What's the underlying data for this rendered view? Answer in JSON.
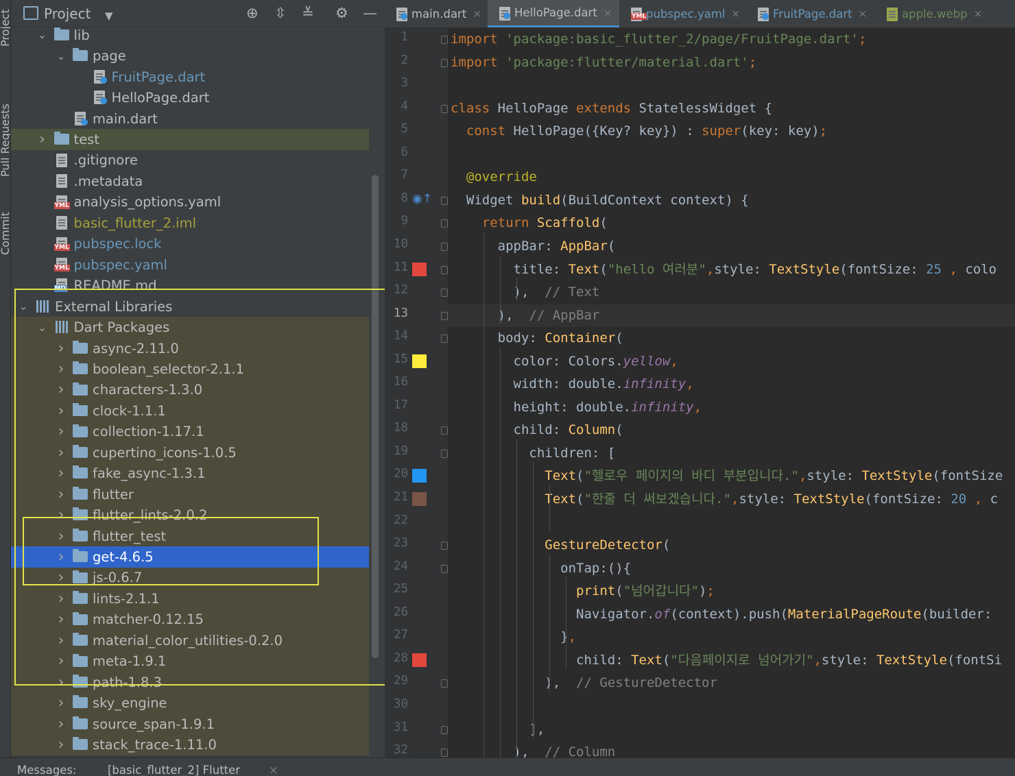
{
  "left_strip": {
    "tabs": [
      "Project",
      "Pull Requests",
      "Commit"
    ]
  },
  "project_panel": {
    "title": "Project",
    "icons": [
      "crosshair-icon",
      "expand-all-icon",
      "collapse-all-icon",
      "gear-icon",
      "minimize-icon"
    ],
    "tree": [
      {
        "label": "lib",
        "indent": 1,
        "arrow": "down",
        "icon": "folder",
        "style": "normal"
      },
      {
        "label": "page",
        "indent": 2,
        "arrow": "down",
        "icon": "folder",
        "style": "normal"
      },
      {
        "label": "FruitPage.dart",
        "indent": 3,
        "arrow": "",
        "icon": "dart",
        "style": "modified"
      },
      {
        "label": "HelloPage.dart",
        "indent": 3,
        "arrow": "",
        "icon": "dart",
        "style": "normal"
      },
      {
        "label": "main.dart",
        "indent": 2,
        "arrow": "",
        "icon": "dart",
        "style": "normal"
      },
      {
        "label": "test",
        "indent": 1,
        "arrow": "right",
        "icon": "folder",
        "style": "test"
      },
      {
        "label": ".gitignore",
        "indent": 1,
        "arrow": "",
        "icon": "file",
        "style": "normal"
      },
      {
        "label": ".metadata",
        "indent": 1,
        "arrow": "",
        "icon": "file",
        "style": "normal"
      },
      {
        "label": "analysis_options.yaml",
        "indent": 1,
        "arrow": "",
        "icon": "yml",
        "style": "normal"
      },
      {
        "label": "basic_flutter_2.iml",
        "indent": 1,
        "arrow": "",
        "icon": "file",
        "style": "iml"
      },
      {
        "label": "pubspec.lock",
        "indent": 1,
        "arrow": "",
        "icon": "yml",
        "style": "modified"
      },
      {
        "label": "pubspec.yaml",
        "indent": 1,
        "arrow": "",
        "icon": "yml",
        "style": "modified"
      },
      {
        "label": "README.md",
        "indent": 1,
        "arrow": "",
        "icon": "md",
        "style": "normal"
      },
      {
        "label": "External Libraries",
        "indent": 0,
        "arrow": "down",
        "icon": "libs",
        "style": "normal"
      },
      {
        "label": "Dart Packages",
        "indent": 1,
        "arrow": "down",
        "icon": "libs",
        "style": "tinted"
      },
      {
        "label": "async-2.11.0",
        "indent": 2,
        "arrow": "right",
        "icon": "folder",
        "style": "tinted"
      },
      {
        "label": "boolean_selector-2.1.1",
        "indent": 2,
        "arrow": "right",
        "icon": "folder",
        "style": "tinted"
      },
      {
        "label": "characters-1.3.0",
        "indent": 2,
        "arrow": "right",
        "icon": "folder",
        "style": "tinted"
      },
      {
        "label": "clock-1.1.1",
        "indent": 2,
        "arrow": "right",
        "icon": "folder",
        "style": "tinted"
      },
      {
        "label": "collection-1.17.1",
        "indent": 2,
        "arrow": "right",
        "icon": "folder",
        "style": "tinted"
      },
      {
        "label": "cupertino_icons-1.0.5",
        "indent": 2,
        "arrow": "right",
        "icon": "folder",
        "style": "tinted"
      },
      {
        "label": "fake_async-1.3.1",
        "indent": 2,
        "arrow": "right",
        "icon": "folder",
        "style": "tinted"
      },
      {
        "label": "flutter",
        "indent": 2,
        "arrow": "right",
        "icon": "folder",
        "style": "tinted"
      },
      {
        "label": "flutter_lints-2.0.2",
        "indent": 2,
        "arrow": "right",
        "icon": "folder",
        "style": "tinted"
      },
      {
        "label": "flutter_test",
        "indent": 2,
        "arrow": "right",
        "icon": "folder",
        "style": "tinted"
      },
      {
        "label": "get-4.6.5",
        "indent": 2,
        "arrow": "right",
        "icon": "folder",
        "style": "selected"
      },
      {
        "label": "js-0.6.7",
        "indent": 2,
        "arrow": "right",
        "icon": "folder",
        "style": "tinted"
      },
      {
        "label": "lints-2.1.1",
        "indent": 2,
        "arrow": "right",
        "icon": "folder",
        "style": "tinted"
      },
      {
        "label": "matcher-0.12.15",
        "indent": 2,
        "arrow": "right",
        "icon": "folder",
        "style": "tinted"
      },
      {
        "label": "material_color_utilities-0.2.0",
        "indent": 2,
        "arrow": "right",
        "icon": "folder",
        "style": "tinted"
      },
      {
        "label": "meta-1.9.1",
        "indent": 2,
        "arrow": "right",
        "icon": "folder",
        "style": "tinted"
      },
      {
        "label": "path-1.8.3",
        "indent": 2,
        "arrow": "right",
        "icon": "folder",
        "style": "tinted"
      },
      {
        "label": "sky_engine",
        "indent": 2,
        "arrow": "right",
        "icon": "folder",
        "style": "tinted"
      },
      {
        "label": "source_span-1.9.1",
        "indent": 2,
        "arrow": "right",
        "icon": "folder",
        "style": "tinted"
      },
      {
        "label": "stack_trace-1.11.0",
        "indent": 2,
        "arrow": "right",
        "icon": "folder",
        "style": "tinted"
      }
    ]
  },
  "editor_tabs": [
    {
      "label": "main.dart",
      "icon": "dart",
      "active": false,
      "color": "#bbbbbb"
    },
    {
      "label": "HelloPage.dart",
      "icon": "dart",
      "active": true,
      "color": "#bbbbbb"
    },
    {
      "label": "pubspec.yaml",
      "icon": "yml",
      "active": false,
      "color": "#6897bb"
    },
    {
      "label": "FruitPage.dart",
      "icon": "dart",
      "active": false,
      "color": "#6897bb"
    },
    {
      "label": "apple.webp",
      "icon": "file",
      "active": false,
      "color": "#6a8759"
    }
  ],
  "current_line": 13,
  "gutter_swatches": {
    "11": "#e2483d",
    "15": "#ffeb3b",
    "20": "#2196f3",
    "21": "#795548",
    "28": "#e2483d"
  },
  "code_lines": [
    [
      [
        "k",
        "import "
      ],
      [
        "s",
        "'package:basic_flutter_2/page/FruitPage.dart'"
      ],
      [
        "k",
        ";"
      ]
    ],
    [
      [
        "k",
        "import "
      ],
      [
        "s",
        "'package:flutter/material.dart'"
      ],
      [
        "k",
        ";"
      ]
    ],
    [],
    [
      [
        "k",
        "class "
      ],
      [
        "p",
        "HelloPage "
      ],
      [
        "k",
        "extends "
      ],
      [
        "p",
        "StatelessWidget {"
      ]
    ],
    [
      [
        "p",
        "  "
      ],
      [
        "k",
        "const "
      ],
      [
        "p",
        "HelloPage({Key? key}) : "
      ],
      [
        "k",
        "super"
      ],
      [
        "p",
        "(key: key)"
      ],
      [
        "k",
        ";"
      ]
    ],
    [],
    [
      [
        "p",
        "  "
      ],
      [
        "a",
        "@override"
      ]
    ],
    [
      [
        "p",
        "  Widget "
      ],
      [
        "t",
        "build"
      ],
      [
        "p",
        "(BuildContext context) {"
      ]
    ],
    [
      [
        "p",
        "    "
      ],
      [
        "k",
        "return "
      ],
      [
        "t",
        "Scaffold"
      ],
      [
        "p",
        "("
      ]
    ],
    [
      [
        "p",
        "      appBar: "
      ],
      [
        "t",
        "AppBar"
      ],
      [
        "p",
        "("
      ]
    ],
    [
      [
        "p",
        "        title: "
      ],
      [
        "t",
        "Text"
      ],
      [
        "p",
        "("
      ],
      [
        "s",
        "\"hello 여러분\""
      ],
      [
        "k",
        ","
      ],
      [
        "p",
        "style: "
      ],
      [
        "t",
        "TextStyle"
      ],
      [
        "p",
        "(fontSize: "
      ],
      [
        "n",
        "25"
      ],
      [
        "p",
        " "
      ],
      [
        "k",
        ","
      ],
      [
        "p",
        " colo"
      ]
    ],
    [
      [
        "p",
        "        ),  "
      ],
      [
        "c",
        "// Text"
      ]
    ],
    [
      [
        "p",
        "      ),  "
      ],
      [
        "c",
        "// AppBar"
      ]
    ],
    [
      [
        "p",
        "      body: "
      ],
      [
        "t",
        "Container"
      ],
      [
        "p",
        "("
      ]
    ],
    [
      [
        "p",
        "        color: Colors."
      ],
      [
        "i",
        "yellow"
      ],
      [
        "k",
        ","
      ]
    ],
    [
      [
        "p",
        "        width: double."
      ],
      [
        "i",
        "infinity"
      ],
      [
        "k",
        ","
      ]
    ],
    [
      [
        "p",
        "        height: double."
      ],
      [
        "i",
        "infinity"
      ],
      [
        "k",
        ","
      ]
    ],
    [
      [
        "p",
        "        child: "
      ],
      [
        "t",
        "Column"
      ],
      [
        "p",
        "("
      ]
    ],
    [
      [
        "p",
        "          children: ["
      ]
    ],
    [
      [
        "p",
        "            "
      ],
      [
        "t",
        "Text"
      ],
      [
        "p",
        "("
      ],
      [
        "s",
        "\"헬로우 페이지의 바디 부분입니다.\""
      ],
      [
        "k",
        ","
      ],
      [
        "p",
        "style: "
      ],
      [
        "t",
        "TextStyle"
      ],
      [
        "p",
        "(fontSize"
      ]
    ],
    [
      [
        "p",
        "            "
      ],
      [
        "t",
        "Text"
      ],
      [
        "p",
        "("
      ],
      [
        "s",
        "\"한줄 더 써보겠습니다.\""
      ],
      [
        "k",
        ","
      ],
      [
        "p",
        "style: "
      ],
      [
        "t",
        "TextStyle"
      ],
      [
        "p",
        "(fontSize: "
      ],
      [
        "n",
        "20"
      ],
      [
        "p",
        " "
      ],
      [
        "k",
        ","
      ],
      [
        "p",
        " c"
      ]
    ],
    [],
    [
      [
        "p",
        "            "
      ],
      [
        "t",
        "GestureDetector"
      ],
      [
        "p",
        "("
      ]
    ],
    [
      [
        "p",
        "              onTap:(){"
      ]
    ],
    [
      [
        "p",
        "                "
      ],
      [
        "t",
        "print"
      ],
      [
        "p",
        "("
      ],
      [
        "s",
        "\"넘어갑니다\""
      ],
      [
        "p",
        ")"
      ],
      [
        "k",
        ";"
      ]
    ],
    [
      [
        "p",
        "                Navigator."
      ],
      [
        "i",
        "of"
      ],
      [
        "p",
        "(context).push("
      ],
      [
        "t",
        "MaterialPageRoute"
      ],
      [
        "p",
        "(builder:"
      ]
    ],
    [
      [
        "p",
        "              }"
      ],
      [
        "k",
        ","
      ]
    ],
    [
      [
        "p",
        "                child: "
      ],
      [
        "t",
        "Text"
      ],
      [
        "p",
        "("
      ],
      [
        "s",
        "\"다음페이지로 넘어가기\""
      ],
      [
        "k",
        ","
      ],
      [
        "p",
        "style: "
      ],
      [
        "t",
        "TextStyle"
      ],
      [
        "p",
        "(fontSi"
      ]
    ],
    [
      [
        "p",
        "            ),  "
      ],
      [
        "c",
        "// GestureDetector"
      ]
    ],
    [],
    [
      [
        "p",
        "          ],"
      ]
    ],
    [
      [
        "p",
        "        ),  "
      ],
      [
        "c",
        "// Column"
      ]
    ]
  ],
  "bottom_bar": {
    "label": "Messages:",
    "tab": "[basic_flutter_2] Flutter",
    "close": "×"
  }
}
